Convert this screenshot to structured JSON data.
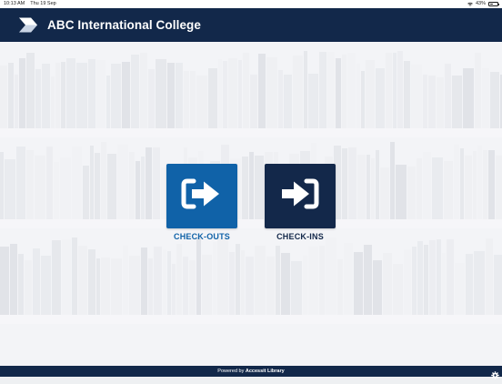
{
  "status_bar": {
    "time": "10:13 AM",
    "date": "Thu 19 Sep",
    "battery": "43%",
    "battery_level": 0.43,
    "icons": [
      "wifi-icon",
      "battery-icon"
    ]
  },
  "header": {
    "title": "ABC International College",
    "logo_icon": "chevron-logo-icon"
  },
  "actions": {
    "checkouts": {
      "label": "CHECK-OUTS",
      "icon": "check-out-arrow-icon",
      "color": "#1062a8"
    },
    "checkins": {
      "label": "CHECK-INS",
      "icon": "check-in-arrow-icon",
      "color": "#13284a"
    }
  },
  "footer": {
    "powered_by": "Powered by",
    "brand": "Accessit Library",
    "settings_icon": "gear-icon"
  },
  "colors": {
    "header_bg": "#12284a",
    "footer_bg": "#12284a"
  }
}
